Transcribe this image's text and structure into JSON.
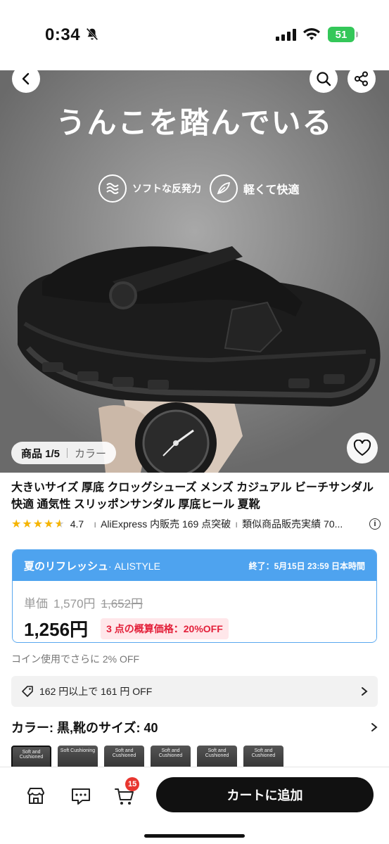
{
  "status_bar": {
    "time": "0:34",
    "battery": "51"
  },
  "hero": {
    "headline": "うんこを踏んでいる",
    "features": [
      {
        "label": "ソフトな反発力",
        "icon": "wave-cushion-icon"
      },
      {
        "label": "軽くて快適",
        "icon": "feather-icon"
      }
    ],
    "counter_label": "商品 1/5",
    "color_label": "カラー"
  },
  "product": {
    "title": "大きいサイズ 厚底 クロッグシューズ メンズ カジュアル ビーチサンダル 快適 通気性 スリッポンサンダル 厚底ヒール 夏靴",
    "rating": "4.7",
    "stars": 4.7,
    "sold_text": "AliExpress 内販売 169 点突破",
    "similar_text": "類似商品販売実績 70..."
  },
  "promo": {
    "campaign": "夏のリフレッシュ",
    "brand": "· ALISTYLE",
    "ends": "終了：5月15日 23:59 日本時間",
    "unit_price_label": "単価",
    "unit_price": "1,570円",
    "original_price": "1,652円",
    "price": "1,256円",
    "bundle": "3 点の概算価格：20%OFF"
  },
  "coin_text": "コイン使用でさらに 2% OFF",
  "coupon_text": "162 円以上で 161 円 OFF",
  "variant": {
    "label": "カラー: 黒,靴のサイズ: 40",
    "thumbs": [
      "Soft and Cushioned",
      "Soft Cushioning",
      "Soft and Cushioned",
      "Soft and Cushioned",
      "Soft and Cushioned",
      "Soft and Cushioned"
    ]
  },
  "bottom": {
    "cart_count": "15",
    "add_to_cart": "カートに追加"
  },
  "colors": {
    "accent_blue": "#4ea3ef",
    "price_red": "#e3203a",
    "star": "#f5b400",
    "badge": "#e8362f"
  }
}
